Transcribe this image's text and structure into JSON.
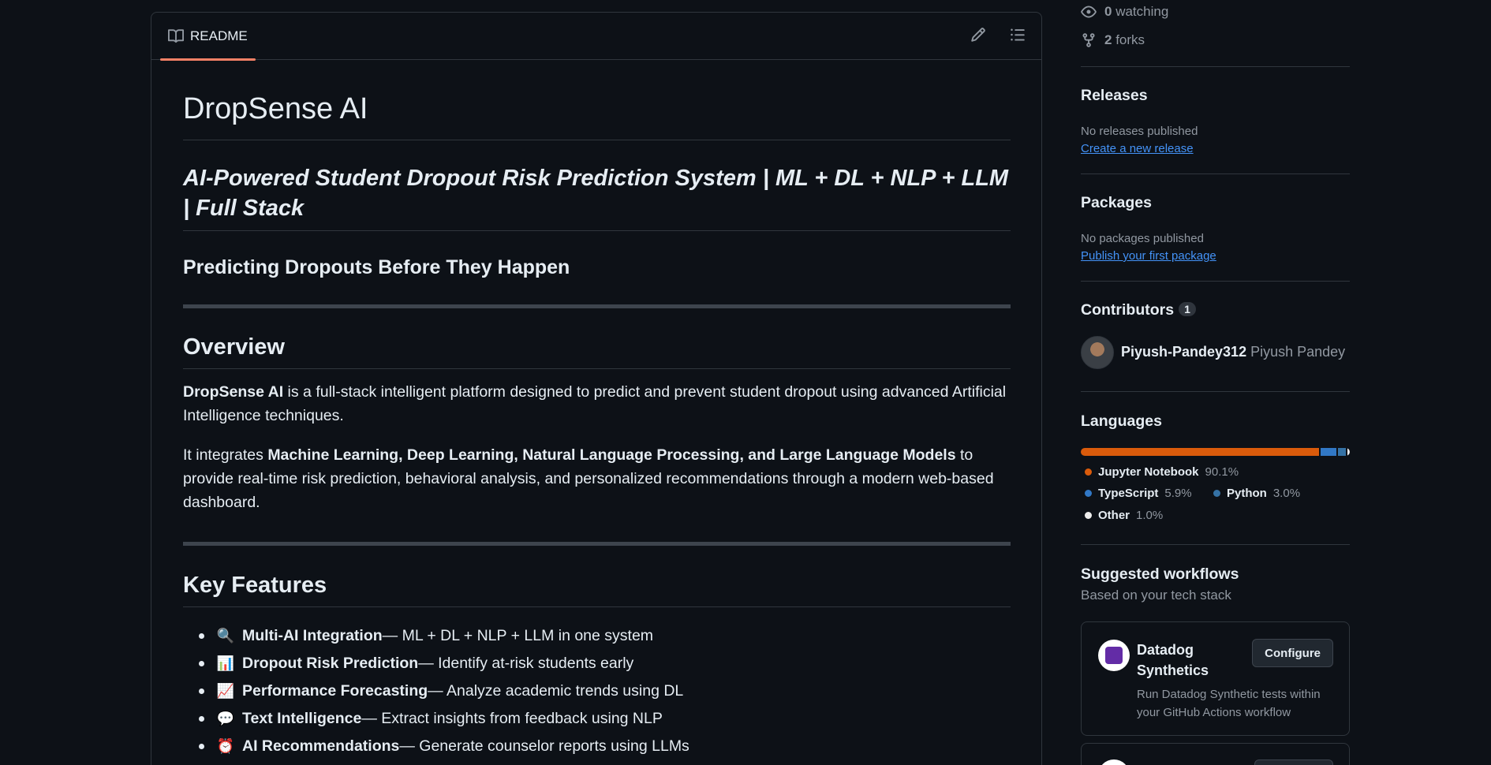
{
  "readme": {
    "tab_label": "README",
    "title": "DropSense AI",
    "subtitle": "AI-Powered Student Dropout Risk Prediction System | ML + DL + NLP + LLM | Full Stack",
    "tagline": "Predicting Dropouts Before They Happen",
    "overview": {
      "heading": "Overview",
      "p1_bold": "DropSense AI",
      "p1_rest": " is a full-stack intelligent platform designed to predict and prevent student dropout using advanced Artificial Intelligence techniques.",
      "p2_start": "It integrates ",
      "p2_bold": "Machine Learning, Deep Learning, Natural Language Processing, and Large Language Models",
      "p2_rest": " to provide real-time risk prediction, behavioral analysis, and personalized recommendations through a modern web-based dashboard."
    },
    "features": {
      "heading": "Key Features",
      "items": [
        {
          "emoji": "🔍",
          "title": "Multi-AI Integration",
          "desc": " — ML + DL + NLP + LLM in one system"
        },
        {
          "emoji": "📊",
          "title": "Dropout Risk Prediction",
          "desc": " — Identify at-risk students early"
        },
        {
          "emoji": "📈",
          "title": "Performance Forecasting",
          "desc": " — Analyze academic trends using DL"
        },
        {
          "emoji": "💬",
          "title": "Text Intelligence",
          "desc": " — Extract insights from feedback using NLP"
        },
        {
          "emoji": "⏰",
          "title": "AI Recommendations",
          "desc": " — Generate counselor reports using LLMs"
        }
      ]
    }
  },
  "sidebar": {
    "watching_count": "0",
    "watching_label": "watching",
    "forks_count": "2",
    "forks_label": "forks",
    "releases": {
      "title": "Releases",
      "empty": "No releases published",
      "link": "Create a new release"
    },
    "packages": {
      "title": "Packages",
      "empty": "No packages published",
      "link": "Publish your first package"
    },
    "contributors": {
      "title": "Contributors",
      "count": "1",
      "login": "Piyush-Pandey312",
      "name": "Piyush Pandey"
    },
    "languages": {
      "title": "Languages",
      "items": [
        {
          "name": "Jupyter Notebook",
          "percent": "90.1%",
          "value": 90.1,
          "color": "#DA5B0B"
        },
        {
          "name": "TypeScript",
          "percent": "5.9%",
          "value": 5.9,
          "color": "#3178c6"
        },
        {
          "name": "Python",
          "percent": "3.0%",
          "value": 3.0,
          "color": "#3572A5"
        },
        {
          "name": "Other",
          "percent": "1.0%",
          "value": 1.0,
          "color": "#ededed"
        }
      ]
    },
    "workflows": {
      "title": "Suggested workflows",
      "subtitle": "Based on your tech stack",
      "card": {
        "name": "Datadog Synthetics",
        "button": "Configure",
        "desc": "Run Datadog Synthetic tests within your GitHub Actions workflow"
      }
    }
  }
}
